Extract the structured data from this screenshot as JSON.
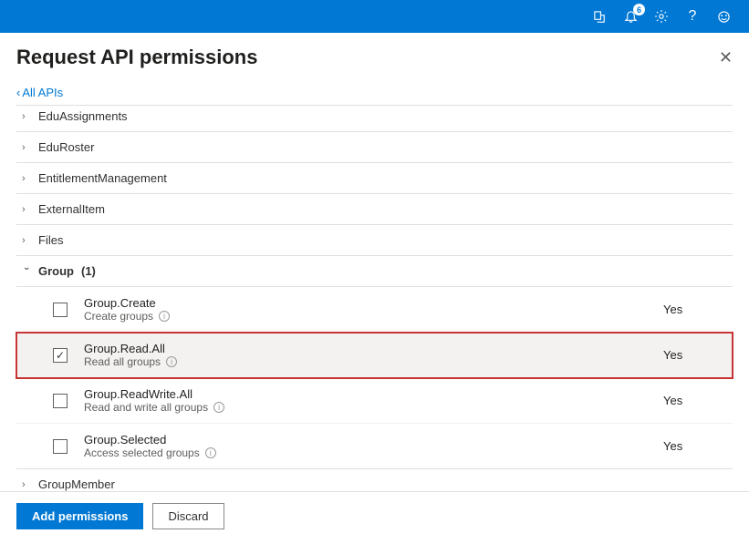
{
  "topbar": {
    "notification_count": "6"
  },
  "header": {
    "title": "Request API permissions",
    "back_label": "All APIs"
  },
  "categories": {
    "cut_top": "EduAssignments",
    "items": [
      "EduRoster",
      "EntitlementManagement",
      "ExternalItem",
      "Files"
    ],
    "expanded": {
      "label": "Group",
      "count": "(1)"
    },
    "after": "GroupMember"
  },
  "permissions": [
    {
      "name": "Group.Create",
      "desc": "Create groups",
      "checked": false,
      "admin": "Yes",
      "highlight": false
    },
    {
      "name": "Group.Read.All",
      "desc": "Read all groups",
      "checked": true,
      "admin": "Yes",
      "highlight": true
    },
    {
      "name": "Group.ReadWrite.All",
      "desc": "Read and write all groups",
      "checked": false,
      "admin": "Yes",
      "highlight": false
    },
    {
      "name": "Group.Selected",
      "desc": "Access selected groups",
      "checked": false,
      "admin": "Yes",
      "highlight": false
    }
  ],
  "footer": {
    "primary": "Add permissions",
    "secondary": "Discard"
  }
}
